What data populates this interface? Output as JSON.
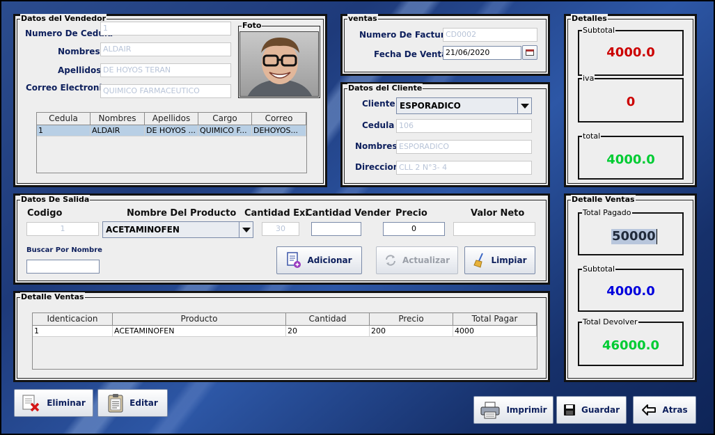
{
  "colors": {
    "red_value": "#cc0000",
    "green_value": "#00cc33",
    "blue_value": "#0000dd",
    "label_navy": "#0d1f5c"
  },
  "vendedor": {
    "title": "Datos del Vendedor",
    "cedula_label": "Numero De Cedula",
    "cedula_value": "1",
    "nombres_label": "Nombres",
    "nombres_value": "ALDAIR",
    "apellidos_label": "Apellidos",
    "apellidos_value": "DE HOYOS TERAN",
    "correo_label": "Correo Electronico",
    "correo_value": "QUIMICO FARMACEUTICO",
    "foto_label": "Foto",
    "table": {
      "headers": [
        "Cedula",
        "Nombres",
        "Apellidos",
        "Cargo",
        "Correo"
      ],
      "rows": [
        [
          "1",
          "ALDAIR",
          "DE HOYOS ...",
          "QUIMICO F...",
          "DEHOYOS..."
        ]
      ]
    }
  },
  "ventas": {
    "title": "ventas",
    "factura_label": "Numero De Factura",
    "factura_value": "CD0002",
    "fecha_label": "Fecha De Venta",
    "fecha_value": "21/06/2020",
    "calendar_icon": "calendar-icon"
  },
  "cliente": {
    "title": "Datos del Cliente",
    "cliente_label": "Cliente",
    "cliente_selected": "ESPORADICO",
    "cedula_label": "Cedula",
    "cedula_value": "106",
    "nombres_label": "Nombres",
    "nombres_value": "ESPORADICO",
    "direccion_label": "Direccion",
    "direccion_value": "CLL 2 N°3- 4"
  },
  "detalles": {
    "title": "Detalles",
    "subtotal_label": "Subtotal",
    "subtotal_value": "4000.0",
    "iva_label": "iva",
    "iva_value": "0",
    "total_label": "total",
    "total_value": "4000.0"
  },
  "salida": {
    "title": "Datos De Salida",
    "codigo_label": "Codigo",
    "codigo_value": "1",
    "producto_label": "Nombre Del Producto",
    "producto_selected": "ACETAMINOFEN",
    "cantidad_exi_label": "Cantidad Exi",
    "cantidad_exi_value": "30",
    "cantidad_vender_label": "Cantidad Vender",
    "cantidad_vender_value": "",
    "precio_label": "Precio",
    "precio_value": "0",
    "valor_neto_label": "Valor Neto",
    "valor_neto_value": "",
    "buscar_label": "Buscar Por Nombre",
    "buscar_value": "",
    "adicionar_label": "Adicionar",
    "actualizar_label": "Actualizar",
    "limpiar_label": "Limpiar"
  },
  "detalle_ventas_table": {
    "title": "Detalle Ventas",
    "headers": [
      "Identicacion",
      "Producto",
      "Cantidad",
      "Precio",
      "Total Pagar"
    ],
    "rows": [
      [
        "1",
        "ACETAMINOFEN",
        "20",
        "200",
        "4000"
      ]
    ]
  },
  "detalle_ventas_summary": {
    "title": "Detalle Ventas",
    "total_pagado_label": "Total Pagado",
    "total_pagado_value": "50000",
    "subtotal_label": "Subtotal",
    "subtotal_value": "4000.0",
    "total_devolver_label": "Total Devolver",
    "total_devolver_value": "46000.0"
  },
  "footer": {
    "eliminar_label": "Eliminar",
    "editar_label": "Editar",
    "imprimir_label": "Imprimir",
    "guardar_label": "Guardar",
    "atras_label": "Atras"
  }
}
